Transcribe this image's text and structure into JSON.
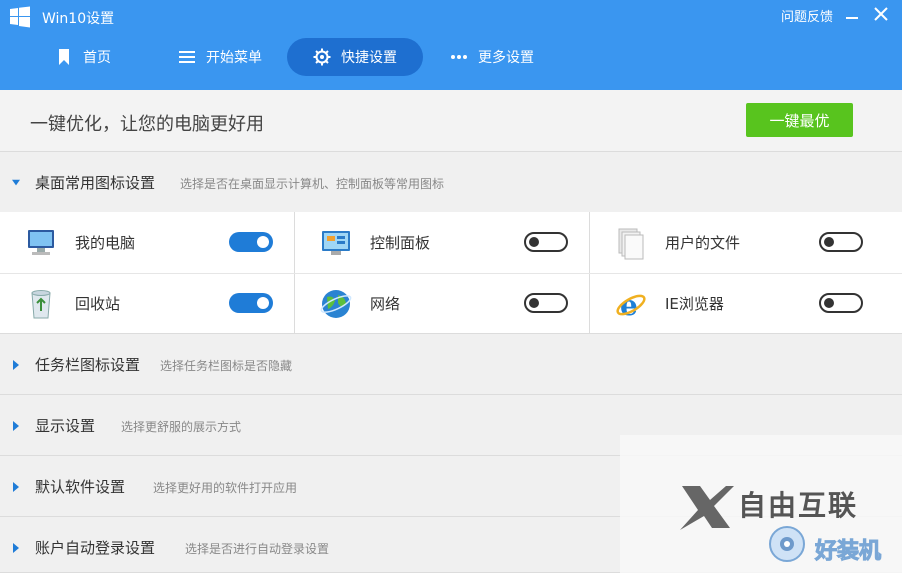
{
  "window": {
    "title": "Win10设置",
    "feedback": "问题反馈",
    "minimize_icon": "minimize-icon",
    "close_icon": "close-icon"
  },
  "colors": {
    "header_bg": "#3a96f0",
    "active_tab_bg": "#1e6fd0",
    "toggle_on": "#1f7cd7",
    "optimize_btn": "#58c41e"
  },
  "nav": {
    "items": [
      {
        "label": "首页",
        "icon": "bookmark-icon"
      },
      {
        "label": "开始菜单",
        "icon": "menu-icon"
      },
      {
        "label": "快捷设置",
        "icon": "gear-icon",
        "active": true
      },
      {
        "label": "更多设置",
        "icon": "more-icon"
      }
    ]
  },
  "optimize": {
    "text": "一键优化，让您的电脑更好用",
    "button": "一键最优"
  },
  "sections": [
    {
      "title": "桌面常用图标设置",
      "desc": "选择是否在桌面显示计算机、控制面板等常用图标",
      "expanded": true
    },
    {
      "title": "任务栏图标设置",
      "desc": "选择任务栏图标是否隐藏",
      "expanded": false
    },
    {
      "title": "显示设置",
      "desc": "选择更舒服的展示方式",
      "expanded": false
    },
    {
      "title": "默认软件设置",
      "desc": "选择更好用的软件打开应用",
      "expanded": false
    },
    {
      "title": "账户自动登录设置",
      "desc": "选择是否进行自动登录设置",
      "expanded": false
    }
  ],
  "desktop_icons": [
    {
      "label": "我的电脑",
      "icon": "computer-icon",
      "enabled": true
    },
    {
      "label": "控制面板",
      "icon": "control-panel-icon",
      "enabled": false
    },
    {
      "label": "用户的文件",
      "icon": "documents-icon",
      "enabled": false
    },
    {
      "label": "回收站",
      "icon": "recycle-bin-icon",
      "enabled": true
    },
    {
      "label": "网络",
      "icon": "network-icon",
      "enabled": false
    },
    {
      "label": "IE浏览器",
      "icon": "ie-browser-icon",
      "enabled": false
    }
  ],
  "watermark": {
    "line1": "自由互联",
    "line2": "好装机"
  }
}
